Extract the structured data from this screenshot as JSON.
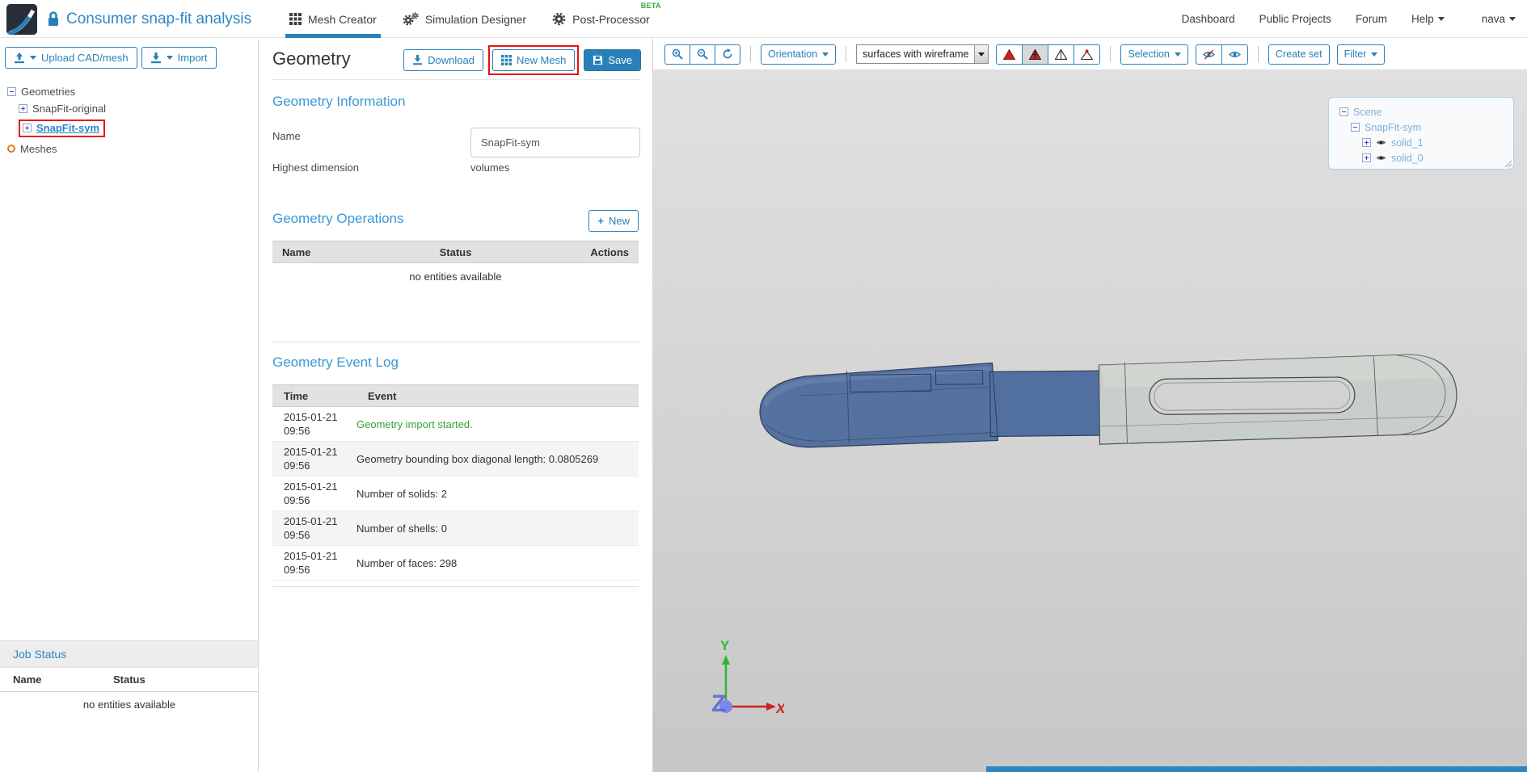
{
  "header": {
    "title": "Consumer snap-fit analysis",
    "tabs": {
      "mesh_creator": "Mesh Creator",
      "simulation_designer": "Simulation Designer",
      "post_processor": "Post-Processor",
      "beta_badge": "BETA"
    },
    "nav": {
      "dashboard": "Dashboard",
      "public_projects": "Public Projects",
      "forum": "Forum",
      "help": "Help",
      "user": "nava"
    }
  },
  "sidebar": {
    "upload_button": "Upload CAD/mesh",
    "import_button": "Import",
    "tree": {
      "root": "Geometries",
      "item_original": "SnapFit-original",
      "item_sym": "SnapFit-sym",
      "meshes": "Meshes"
    },
    "job_status": {
      "title": "Job Status",
      "col_name": "Name",
      "col_status": "Status",
      "empty": "no entities available"
    }
  },
  "panel": {
    "title": "Geometry",
    "buttons": {
      "download": "Download",
      "new_mesh": "New Mesh",
      "save": "Save"
    },
    "info": {
      "heading": "Geometry Information",
      "name_label": "Name",
      "name_value": "SnapFit-sym",
      "dim_label": "Highest dimension",
      "dim_value": "volumes"
    },
    "operations": {
      "heading": "Geometry Operations",
      "new_button": "New",
      "col_name": "Name",
      "col_status": "Status",
      "col_actions": "Actions",
      "empty": "no entities available"
    },
    "event_log": {
      "heading": "Geometry Event Log",
      "col_time": "Time",
      "col_event": "Event",
      "rows": [
        {
          "time": "2015-01-21 09:56",
          "event": "Geometry import started."
        },
        {
          "time": "2015-01-21 09:56",
          "event": "Geometry bounding box diagonal length: 0.0805269"
        },
        {
          "time": "2015-01-21 09:56",
          "event": "Number of solids: 2"
        },
        {
          "time": "2015-01-21 09:56",
          "event": "Number of shells: 0"
        },
        {
          "time": "2015-01-21 09:56",
          "event": "Number of faces: 298"
        }
      ]
    }
  },
  "viewport": {
    "toolbar": {
      "orientation": "Orientation",
      "render_mode": "surfaces with wireframe",
      "selection": "Selection",
      "create_set": "Create set",
      "filter": "Filter"
    },
    "scene_tree": {
      "root": "Scene",
      "geometry": "SnapFit-sym",
      "solids": [
        "solid_1",
        "solid_0"
      ]
    },
    "axes": {
      "x": "X",
      "y": "Y",
      "z": "Z"
    }
  },
  "colors": {
    "accent": "#2980b9",
    "heading": "#3b98d5",
    "success": "#35a035",
    "annotation": "#e8100c",
    "model_blue": "#55719f",
    "model_gray": "#c8cec9"
  }
}
